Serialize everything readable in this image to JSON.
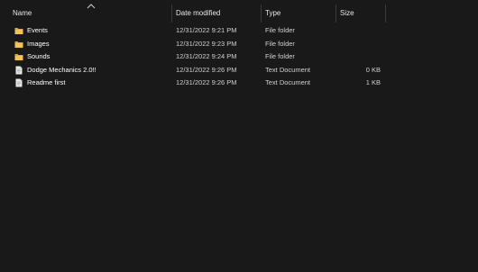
{
  "columns": {
    "name": "Name",
    "date": "Date modified",
    "type": "Type",
    "size": "Size"
  },
  "files": [
    {
      "name": "Events",
      "date": "12/31/2022 9:21 PM",
      "type": "File folder",
      "size": "",
      "icon": "folder-icon"
    },
    {
      "name": "Images",
      "date": "12/31/2022 9:23 PM",
      "type": "File folder",
      "size": "",
      "icon": "folder-icon"
    },
    {
      "name": "Sounds",
      "date": "12/31/2022 9:24 PM",
      "type": "File folder",
      "size": "",
      "icon": "folder-icon"
    },
    {
      "name": "Dodge Mechanics 2.0!!",
      "date": "12/31/2022 9:26 PM",
      "type": "Text Document",
      "size": "0 KB",
      "icon": "text-document-icon"
    },
    {
      "name": "Readme first",
      "date": "12/31/2022 9:26 PM",
      "type": "Text Document",
      "size": "1 KB",
      "icon": "text-document-icon"
    }
  ],
  "colors": {
    "background": "#191919",
    "folder": "#f4c54a",
    "document": "#e8e8e8"
  }
}
